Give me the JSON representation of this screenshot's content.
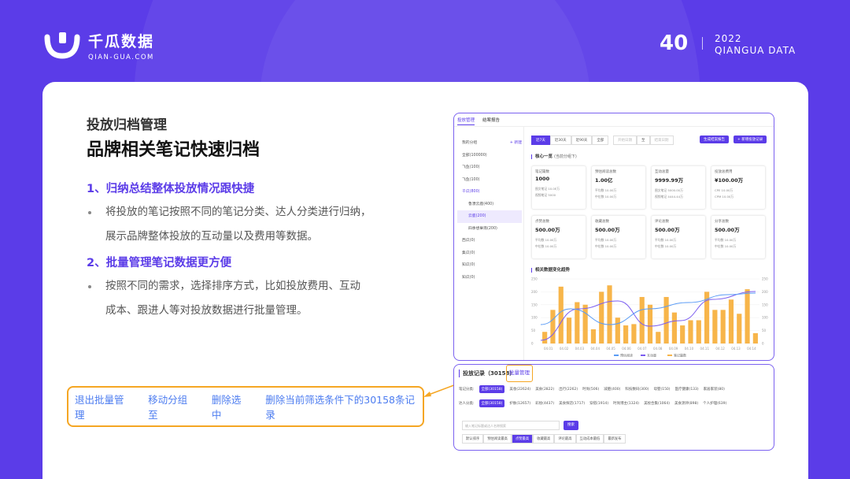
{
  "brand": {
    "logo_cn": "千瓜数据",
    "logo_en": "QIAN-GUA.COM",
    "page_number": "40",
    "year": "2022",
    "sub": "QIANGUA DATA"
  },
  "content": {
    "section_label": "投放归档管理",
    "section_title": "品牌相关笔记快速归档",
    "point1_title": "1、归纳总结整体投放情况跟快捷",
    "point1_line1": "将投放的笔记按照不同的笔记分类、达人分类进行归纳，",
    "point1_line2": "展示品牌整体投放的互动量以及费用等数据。",
    "point2_title": "2、批量管理笔记数据更方便",
    "point2_line1": "按照不同的需求，选择排序方式，比如投放费用、互动",
    "point2_line2": "成本、跟进人等对投放数据进行批量管理。"
  },
  "actions": [
    "退出批量管理",
    "移动分组至",
    "删除选中",
    "删除当前筛选条件下的30158条记录"
  ],
  "shot1": {
    "tabs": [
      "投放管理",
      "结案报告"
    ],
    "tree_header": "我的分组",
    "tree_add": "+ 新建",
    "tree_items": [
      "全部(100000)",
      "飞鱼(100)",
      "飞鱼(100)",
      "千瓜(800)",
      "鲁濮云鹿(400)",
      "云鹿(200)",
      "四季想果南(200)",
      "西瓜(0)",
      "集瓜(0)",
      "知瓜(0)",
      "知瓜(0)"
    ],
    "tree_selected": 5,
    "period_tabs": [
      "近7天",
      "近30天",
      "近90天",
      "全部"
    ],
    "date_from": "开始日期",
    "date_sep": "至",
    "date_to": "结束日期",
    "btn_report": "生成结案报告",
    "btn_new": "+ 新增投放记录",
    "core_title": "核心一览",
    "core_note": "(当前分组下)",
    "kpis": [
      {
        "label": "笔记篇数",
        "value": "1000",
        "s1": "图文笔记 10.0E万",
        "s2": "视频笔记 5000"
      },
      {
        "label": "预估阅读总数",
        "value": "1.00亿",
        "s1": "平均数 10.00万",
        "s2": "中位数 10.00万"
      },
      {
        "label": "互动总量",
        "value": "9999.99万",
        "s1": "图文笔记 5000.00万",
        "s2": "视频笔记 4444.44万"
      },
      {
        "label": "投放总费用",
        "value": "¥100.00万",
        "s1": "CPE 10.00万",
        "s2": "CPM 10.00万"
      },
      {
        "label": "点赞总数",
        "value": "500.00万",
        "s1": "平均数 10.00万",
        "s2": "中位数 10.00万"
      },
      {
        "label": "收藏总数",
        "value": "500.00万",
        "s1": "平均数 10.00万",
        "s2": "中位数 10.00万"
      },
      {
        "label": "评论总数",
        "value": "500.00万",
        "s1": "平均数 10.00万",
        "s2": "中位数 10.00万"
      },
      {
        "label": "分享总数",
        "value": "500.00万",
        "s1": "平均数 10.00万",
        "s2": "中位数 10.00万"
      }
    ],
    "trend_title": "相关数据变化趋势",
    "legend": [
      "预估阅读",
      "互动量",
      "笔记篇数"
    ]
  },
  "chart_data": {
    "type": "bar",
    "categories": [
      "04.01",
      "04.02",
      "04.03",
      "04.04",
      "04.05",
      "04.06",
      "04.07",
      "04.08",
      "04.09",
      "04.10",
      "04.11",
      "04.12",
      "04.13",
      "04.14"
    ],
    "values": [
      45,
      130,
      220,
      100,
      160,
      150,
      55,
      200,
      225,
      100,
      70,
      75,
      180,
      150,
      45,
      180,
      120,
      70,
      90,
      90,
      200,
      130,
      130,
      170,
      115,
      210,
      40
    ],
    "ylim": [
      0,
      250
    ],
    "y2lim": [
      0,
      250
    ],
    "y_ticks": [
      "250",
      "200",
      "150",
      "100",
      "50",
      "0"
    ],
    "colors": {
      "bars": "#F7B54A",
      "line_purple": "#7A5CF0",
      "line_blue": "#5A9BF5"
    }
  },
  "shot2": {
    "title": "投放记录（30158）",
    "batch": "批量管理",
    "row1_label": "笔记分类:",
    "row1": [
      "全部(30158)",
      "美妆(22624)",
      "美食(2822)",
      "出行(2262)",
      "时尚(506)",
      "减肥(400)",
      "科技数码(300)",
      "母婴(150)",
      "医疗健康(133)",
      "家居家装(80)"
    ],
    "row2_label": "达人分类:",
    "row2": [
      "全部(30158)",
      "护肤(12657)",
      "彩妆(4437)",
      "美食探店(1717)",
      "穿搭(1914)",
      "时尚博主(1324)",
      "美妆合集(1064)",
      "美食测评(898)",
      "个人护理(639)"
    ],
    "search_placeholder": "输入笔记标题或达人名称搜索",
    "search_btn": "搜索",
    "sorts": [
      "默认排序",
      "预估阅读最高",
      "点赞最高",
      "收藏最高",
      "评论最高",
      "互动成本最低",
      "最新发布"
    ],
    "sort_active": 2
  }
}
